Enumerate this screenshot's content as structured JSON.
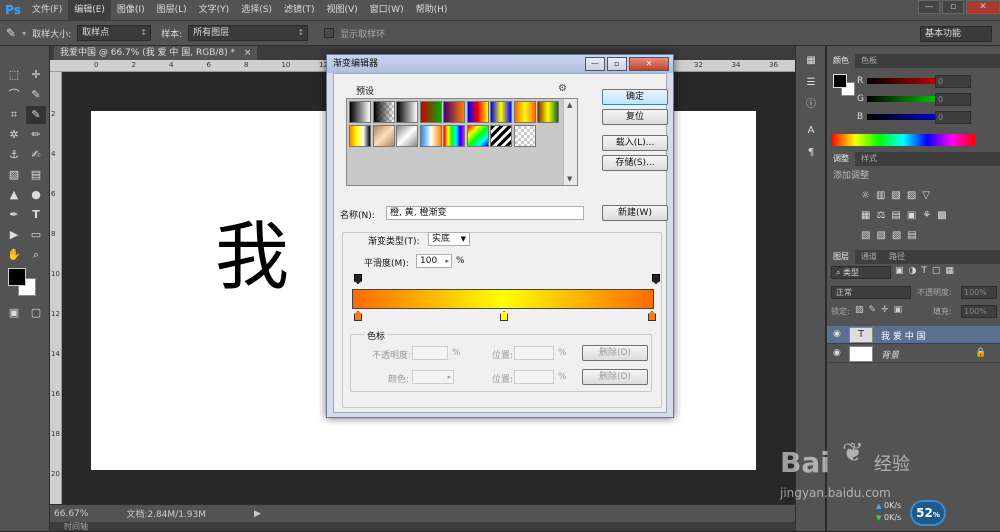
{
  "app": {
    "logo": "Ps"
  },
  "menubar": {
    "items": [
      "文件(F)",
      "编辑(E)",
      "图像(I)",
      "图层(L)",
      "文字(Y)",
      "选择(S)",
      "滤镜(T)",
      "视图(V)",
      "窗口(W)",
      "帮助(H)"
    ],
    "active_index": 1
  },
  "window_controls": {
    "minimize": "—",
    "maximize": "▫",
    "close": "✕"
  },
  "options": {
    "sample_size_label": "取样大小:",
    "sample_size_value": "取样点",
    "sample_label": "样本:",
    "sample_value": "所有图层",
    "show_ring_label": "显示取样环",
    "workspace": "基本功能"
  },
  "document": {
    "tab_label": "我爱中国 @ 66.7% (我 爱 中 国, RGB/8) *",
    "close": "×",
    "canvas_text": "我",
    "ruler_top": [
      "0",
      "2",
      "4",
      "6",
      "8",
      "10",
      "12",
      "14",
      "16",
      "18",
      "20",
      "22",
      "24",
      "26",
      "28",
      "30",
      "32",
      "34",
      "36"
    ],
    "ruler_left": [
      "2",
      "4",
      "6",
      "8",
      "10",
      "12",
      "14",
      "16",
      "18",
      "20"
    ]
  },
  "status": {
    "zoom": "66.67%",
    "doc_info": "文档:2.84M/1.93M",
    "bottom_tab": "时间轴"
  },
  "color_panel": {
    "tabs": [
      "颜色",
      "色板"
    ],
    "r_label": "R",
    "g_label": "G",
    "b_label": "B",
    "r_value": "0",
    "g_value": "0",
    "b_value": "0"
  },
  "adjust_panel": {
    "tabs": [
      "调整",
      "样式"
    ],
    "title": "添加调整"
  },
  "layers_panel": {
    "tabs": [
      "图层",
      "通道",
      "路径"
    ],
    "filter_label": "类型",
    "blend_mode": "正常",
    "opacity_label": "不透明度:",
    "opacity_value": "100%",
    "lock_label": "锁定:",
    "fill_label": "填充:",
    "fill_value": "100%",
    "layers": [
      {
        "name": "我 爱 中 国",
        "thumb": "T",
        "selected": true
      },
      {
        "name": "背景",
        "thumb": "",
        "selected": false
      }
    ]
  },
  "dialog": {
    "title": "渐变编辑器",
    "presets_label": "预设",
    "buttons": {
      "ok": "确定",
      "reset": "复位",
      "load": "载入(L)...",
      "save": "存储(S)...",
      "new": "新建(W)"
    },
    "name_label": "名称(N):",
    "name_value": "橙, 黄, 橙渐变",
    "gradient_type_label": "渐变类型(T):",
    "gradient_type_value": "实底",
    "smoothness_label": "平滑度(M):",
    "smoothness_value": "100",
    "percent": "%",
    "stops_group_label": "色标",
    "opacity_label": "不透明度:",
    "location_label": "位置:",
    "color_label": "颜色:",
    "delete_label": "删除(D)",
    "gradient_colors": [
      "#ff6a00",
      "#ffff00",
      "#ff6a00"
    ]
  },
  "watermark": {
    "brand": "Bai",
    "brand2": "经验",
    "url": "jingyan.baidu.com"
  },
  "network": {
    "up": "0K/s",
    "down": "0K/s",
    "percent": "52"
  }
}
